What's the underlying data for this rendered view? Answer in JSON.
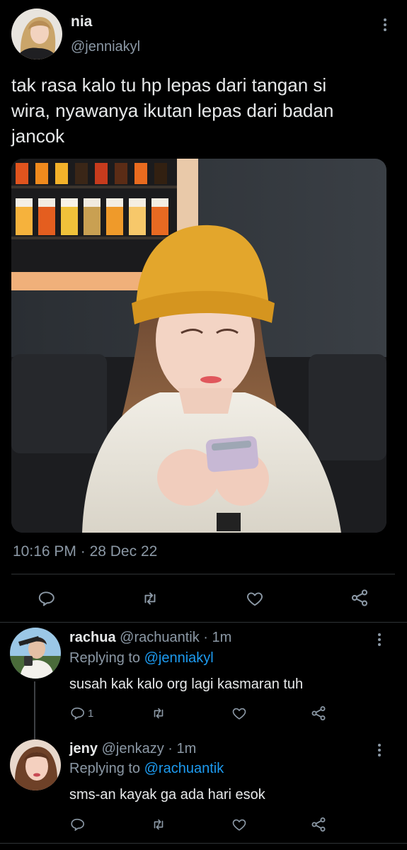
{
  "main_tweet": {
    "display_name": "nia",
    "handle": "@jenniakyl",
    "text_lines": [
      "tak rasa kalo tu hp lepas dari tangan si",
      "wira, nyawanya ikutan lepas dari badan",
      "jancok"
    ],
    "time": "10:16 PM",
    "separator": "·",
    "date": "28 Dec 22",
    "actions": [
      "reply-icon",
      "retweet-icon",
      "like-icon",
      "share-icon"
    ]
  },
  "replies": [
    {
      "display_name": "rachua",
      "handle": "@rachuantik",
      "age": "· 1m",
      "replying_prefix": "Replying to ",
      "replying_to": "@jenniakyl",
      "text": "susah kak kalo org lagi kasmaran tuh",
      "reply_count": "1"
    },
    {
      "display_name": "jeny",
      "handle": "@jenkazy",
      "age": "· 1m",
      "replying_prefix": "Replying to ",
      "replying_to": "@rachuantik",
      "text": "sms-an kayak ga ada hari esok",
      "reply_count": ""
    }
  ],
  "colors": {
    "background": "#000000",
    "text": "#e7e9ea",
    "muted": "#8b98a5",
    "link": "#1d9bf0",
    "divider": "#2f3336",
    "beanie": "#e3a62c"
  }
}
